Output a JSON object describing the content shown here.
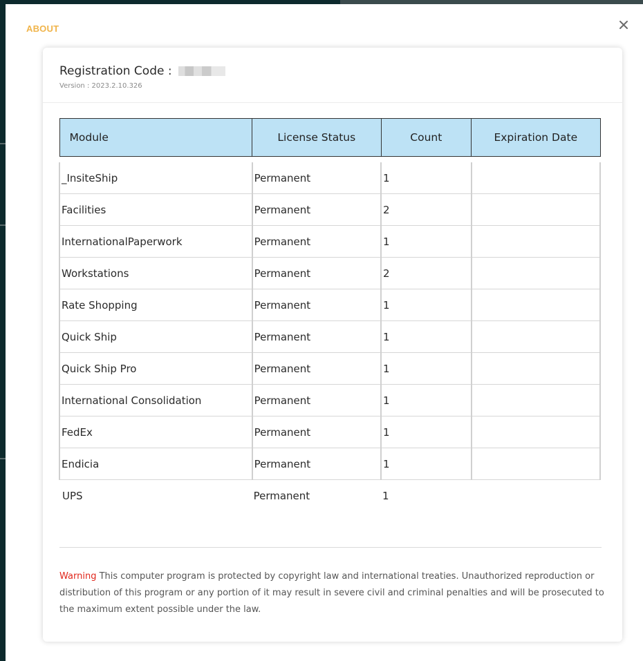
{
  "dialog": {
    "title": "ABOUT",
    "close_icon": "close-icon"
  },
  "registration": {
    "label": "Registration Code : ",
    "version": "Version : 2023.2.10.326"
  },
  "table": {
    "headers": [
      "Module",
      "License Status",
      "Count",
      "Expiration Date"
    ],
    "rows": [
      [
        "_InsiteShip",
        "Permanent",
        "1",
        ""
      ],
      [
        "Facilities",
        "Permanent",
        "2",
        ""
      ],
      [
        "InternationalPaperwork",
        "Permanent",
        "1",
        ""
      ],
      [
        "Workstations",
        "Permanent",
        "2",
        ""
      ],
      [
        "Rate Shopping",
        "Permanent",
        "1",
        ""
      ],
      [
        "Quick Ship",
        "Permanent",
        "1",
        ""
      ],
      [
        "Quick Ship Pro",
        "Permanent",
        "1",
        ""
      ],
      [
        "International Consolidation",
        "Permanent",
        "1",
        ""
      ],
      [
        "FedEx",
        "Permanent",
        "1",
        ""
      ],
      [
        "Endicia",
        "Permanent",
        "1",
        ""
      ],
      [
        "UPS",
        "Permanent",
        "1",
        ""
      ]
    ]
  },
  "footer": {
    "warning_label": "Warning",
    "warning_text": " This computer program is protected by copyright law and international treaties. Unauthorized reproduction or distribution of this program or any portion of it may result in severe civil and criminal penalties and will be prosecuted to the maximum extent possible under the law."
  },
  "colors": {
    "title_accent": "#f0b44a",
    "header_bg": "#bde2f5",
    "alt_row_bg": "#eef8fe",
    "warning": "#e0261b"
  }
}
